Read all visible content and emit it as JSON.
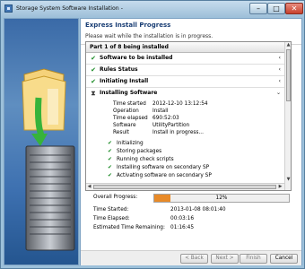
{
  "window": {
    "title": "Storage System Software Installation -",
    "min_glyph": "–",
    "max_glyph": "□",
    "close_glyph": "✕"
  },
  "header": {
    "title": "Express Install Progress",
    "subtitle": "Please wait while the installation is in progress."
  },
  "panel": {
    "title": "Part 1 of 8 being installed",
    "steps": [
      {
        "label": "Software to be installed",
        "status": "done",
        "expanded": false
      },
      {
        "label": "Rules Status",
        "status": "done",
        "expanded": false
      },
      {
        "label": "Initiating Install",
        "status": "done",
        "expanded": false
      },
      {
        "label": "Installing Software",
        "status": "in-progress",
        "expanded": true
      }
    ],
    "details": [
      {
        "key": "Time started",
        "value": "2012-12-10  13:12:54"
      },
      {
        "key": "Operation",
        "value": "Install"
      },
      {
        "key": "Time elapsed",
        "value": "690:52:03"
      },
      {
        "key": "Software",
        "value": "UtilityPartition"
      },
      {
        "key": "Result",
        "value": "Install in progress..."
      }
    ],
    "tasks": [
      "Initializing",
      "Storing packages",
      "Running check scripts",
      "Installing software on secondary SP",
      "Activating software on secondary SP"
    ]
  },
  "overall": {
    "label": "Overall Progress:",
    "percent": 12,
    "percent_text": "12%",
    "time_started_label": "Time Started:",
    "time_started": "2013-01-08 08:01:40",
    "time_elapsed_label": "Time Elapsed:",
    "time_elapsed": "00:03:16",
    "remaining_label": "Estimated Time Remaining:",
    "remaining": "01:16:45",
    "bar_color": "#e88a28"
  },
  "footer": {
    "back": "< Back",
    "next": "Next >",
    "finish": "Finish",
    "cancel": "Cancel"
  },
  "icons": {
    "done": "check-icon",
    "in_progress": "hourglass-icon",
    "expand": "chevron-icon"
  }
}
